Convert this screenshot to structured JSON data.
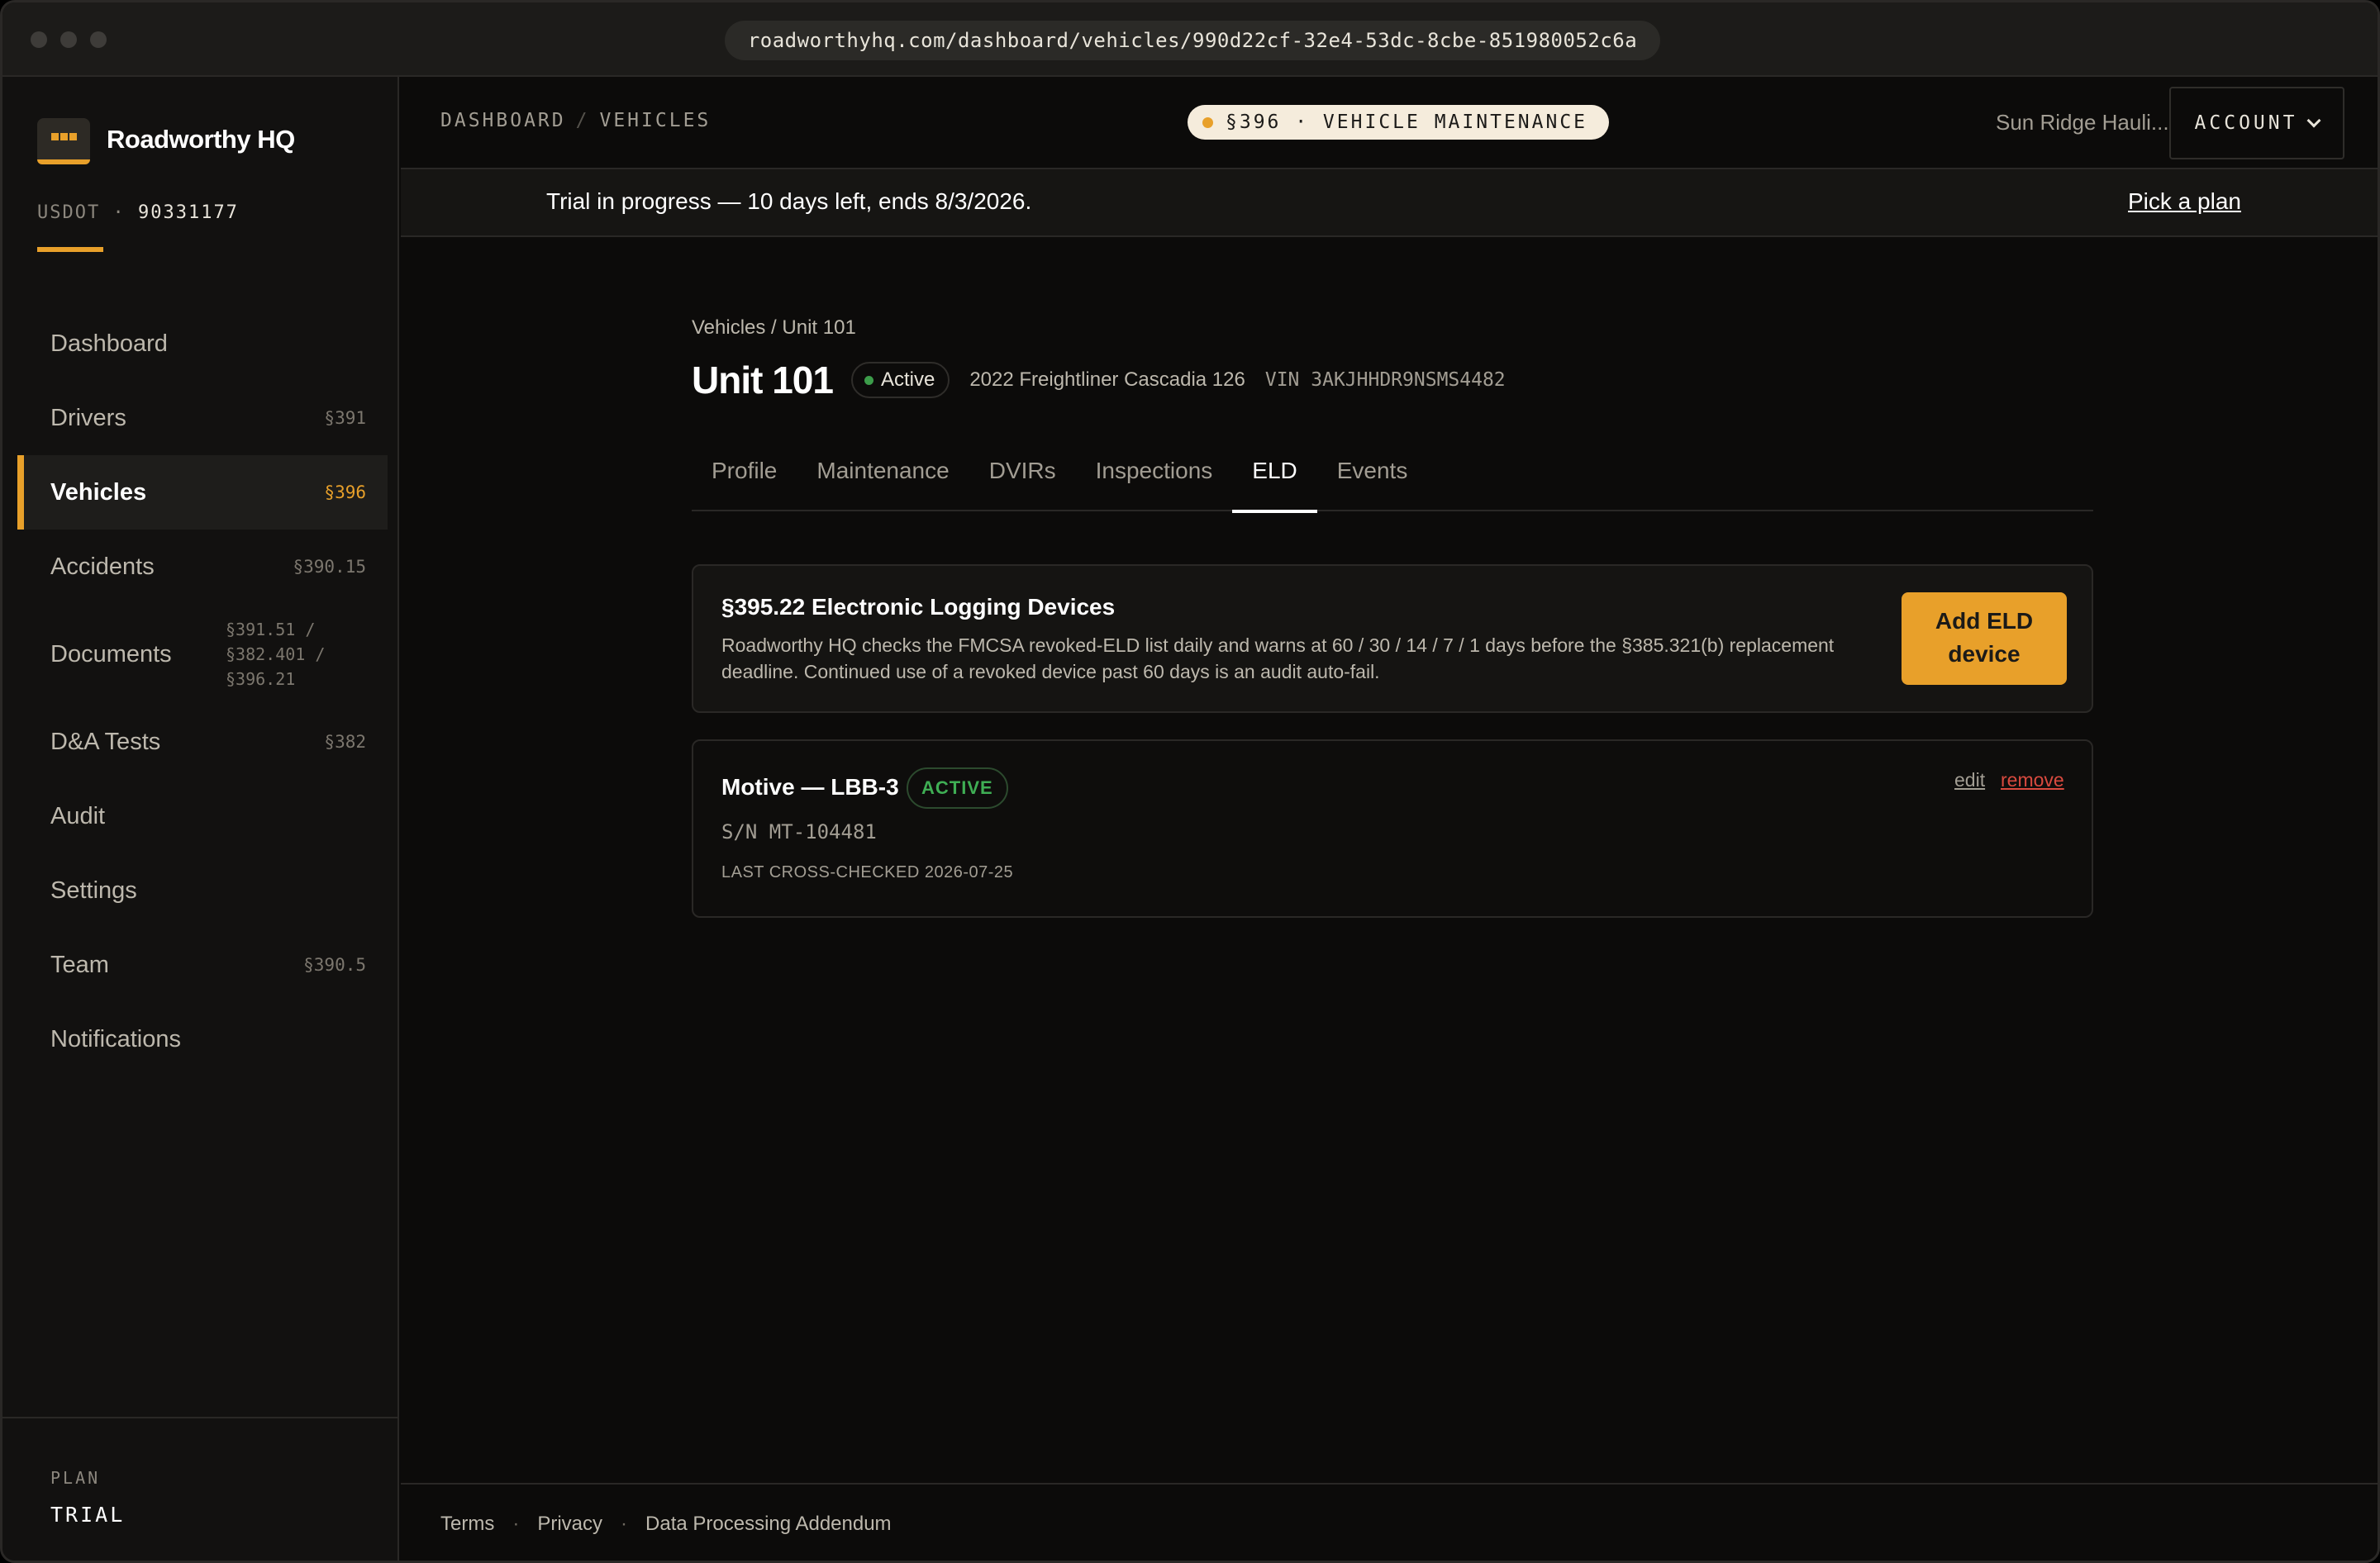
{
  "browser": {
    "url": "roadworthyhq.com/dashboard/vehicles/990d22cf-32e4-53dc-8cbe-851980052c6a"
  },
  "sidebar": {
    "brand": "Roadworthy HQ",
    "usdot_label": "USDOT ·",
    "usdot_number": "90331177",
    "items": [
      {
        "label": "Dashboard",
        "section": ""
      },
      {
        "label": "Drivers",
        "section": "§391"
      },
      {
        "label": "Vehicles",
        "section": "§396"
      },
      {
        "label": "Accidents",
        "section": "§390.15"
      },
      {
        "label": "Documents",
        "section": "§391.51 / §382.401 / §396.21"
      },
      {
        "label": "D&A Tests",
        "section": "§382"
      },
      {
        "label": "Audit",
        "section": ""
      },
      {
        "label": "Settings",
        "section": ""
      },
      {
        "label": "Team",
        "section": "§390.5"
      },
      {
        "label": "Notifications",
        "section": ""
      }
    ],
    "plan_label": "PLAN",
    "plan_value": "TRIAL"
  },
  "topbar": {
    "crumb_1": "DASHBOARD",
    "crumb_sep": "/",
    "crumb_2": "VEHICLES",
    "section_pill": "§396 · VEHICLE MAINTENANCE",
    "org_name": "Sun Ridge Hauli...",
    "account_label": "ACCOUNT"
  },
  "trial": {
    "message": "Trial in progress — 10 days left, ends 8/3/2026.",
    "link": "Pick a plan"
  },
  "vehicle": {
    "breadcrumb": "Vehicles / Unit 101",
    "name": "Unit 101",
    "status": "Active",
    "model": "2022 Freightliner Cascadia 126",
    "vin": "VIN 3AKJHHDR9NSMS4482",
    "tabs": [
      "Profile",
      "Maintenance",
      "DVIRs",
      "Inspections",
      "ELD",
      "Events"
    ],
    "active_tab": "ELD"
  },
  "eld_info": {
    "title": "§395.22 Electronic Logging Devices",
    "description": "Roadworthy HQ checks the FMCSA revoked-ELD list daily and warns at 60 / 30 / 14 / 7 / 1 days before the §385.321(b) replacement deadline. Continued use of a revoked device past 60 days is an audit auto-fail.",
    "add_button": "Add ELD device"
  },
  "eld_device": {
    "name": "Motive — LBB-3",
    "badge": "ACTIVE",
    "serial": "S/N MT-104481",
    "last_checked": "LAST CROSS-CHECKED 2026-07-25",
    "edit_label": "edit",
    "remove_label": "remove"
  },
  "footer": {
    "links": [
      "Terms",
      "Privacy",
      "Data Processing Addendum"
    ],
    "separator": "·"
  },
  "colors": {
    "accent": "#e8a02a",
    "background": "#0c0b0a",
    "success": "#3fae54",
    "danger": "#d94a3f"
  }
}
